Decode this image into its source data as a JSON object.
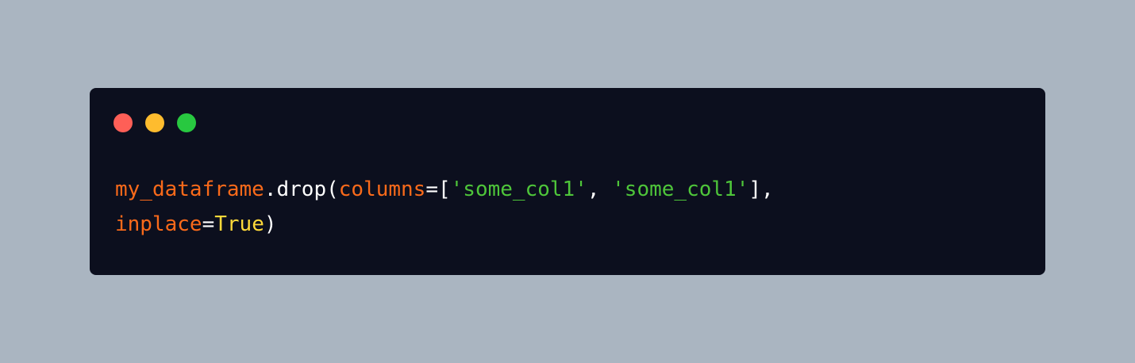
{
  "window": {
    "traffic_lights": [
      {
        "name": "close",
        "color": "#fe5f57"
      },
      {
        "name": "minimize",
        "color": "#febc2e"
      },
      {
        "name": "maximize",
        "color": "#28c840"
      }
    ]
  },
  "code": {
    "line1": {
      "t1": "my_dataframe",
      "t2": ".drop(",
      "t3": "columns",
      "t4": "=[",
      "t5": "'some_col1'",
      "t6": ", ",
      "t7": "'some_col1'",
      "t8": "],"
    },
    "line2": {
      "t1": "inplace",
      "t2": "=",
      "t3": "True",
      "t4": ")"
    }
  }
}
